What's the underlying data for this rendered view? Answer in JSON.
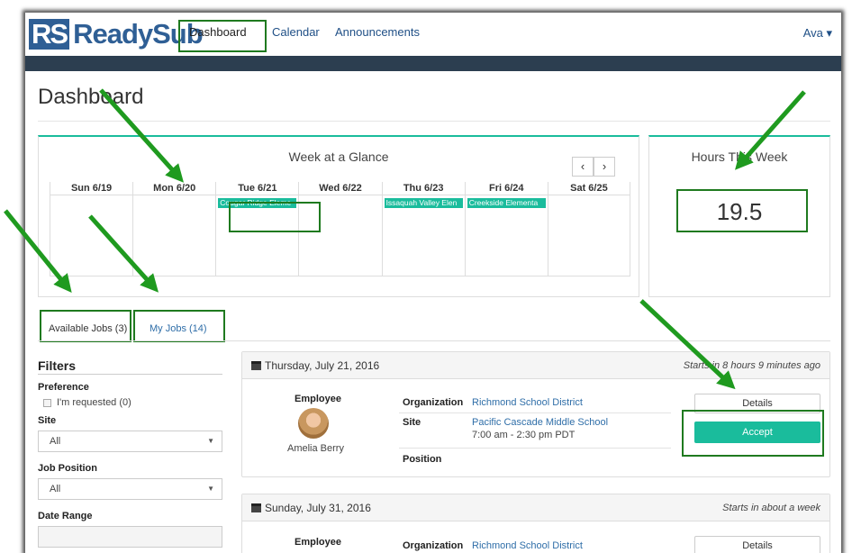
{
  "brand": {
    "logo_mark": "RS",
    "logo_name": "ReadySub"
  },
  "nav": {
    "dashboard": "Dashboard",
    "calendar": "Calendar",
    "announcements": "Announcements",
    "user": "Ava ▾"
  },
  "page": {
    "title": "Dashboard"
  },
  "week": {
    "title": "Week at a Glance",
    "prev": "‹",
    "next": "›",
    "days": [
      {
        "label": "Sun 6/19",
        "event": ""
      },
      {
        "label": "Mon 6/20",
        "event": ""
      },
      {
        "label": "Tue 6/21",
        "event": "Cougar Ridge Eleme"
      },
      {
        "label": "Wed 6/22",
        "event": ""
      },
      {
        "label": "Thu 6/23",
        "event": "Issaquah Valley Elen"
      },
      {
        "label": "Fri 6/24",
        "event": "Creekside Elementa"
      },
      {
        "label": "Sat 6/25",
        "event": ""
      }
    ]
  },
  "hours": {
    "title": "Hours This Week",
    "value": "19.5"
  },
  "tabs": {
    "available": "Available Jobs (3)",
    "mine": "My Jobs (14)"
  },
  "filters": {
    "title": "Filters",
    "preference_label": "Preference",
    "requested_label": "I'm requested (0)",
    "site_label": "Site",
    "site_value": "All",
    "position_label": "Job Position",
    "position_value": "All",
    "date_range_label": "Date Range"
  },
  "jobs": [
    {
      "date": "Thursday, July 21, 2016",
      "when": "Starts in 8 hours 9 minutes ago",
      "employee_label": "Employee",
      "employee_name": "Amelia Berry",
      "org_key": "Organization",
      "org_val": "Richmond School District",
      "site_key": "Site",
      "site_val": "Pacific Cascade Middle School",
      "time_val": "7:00 am - 2:30 pm PDT",
      "position_key": "Position",
      "details_label": "Details",
      "accept_label": "Accept"
    },
    {
      "date": "Sunday, July 31, 2016",
      "when": "Starts in about a week",
      "employee_label": "Employee",
      "org_key": "Organization",
      "org_val": "Richmond School District",
      "details_label": "Details"
    }
  ],
  "colors": {
    "accent": "#1abc9c",
    "brand": "#2f5f95",
    "annotation": "#1f9a1f",
    "navbar_dark": "#2c3e50"
  }
}
